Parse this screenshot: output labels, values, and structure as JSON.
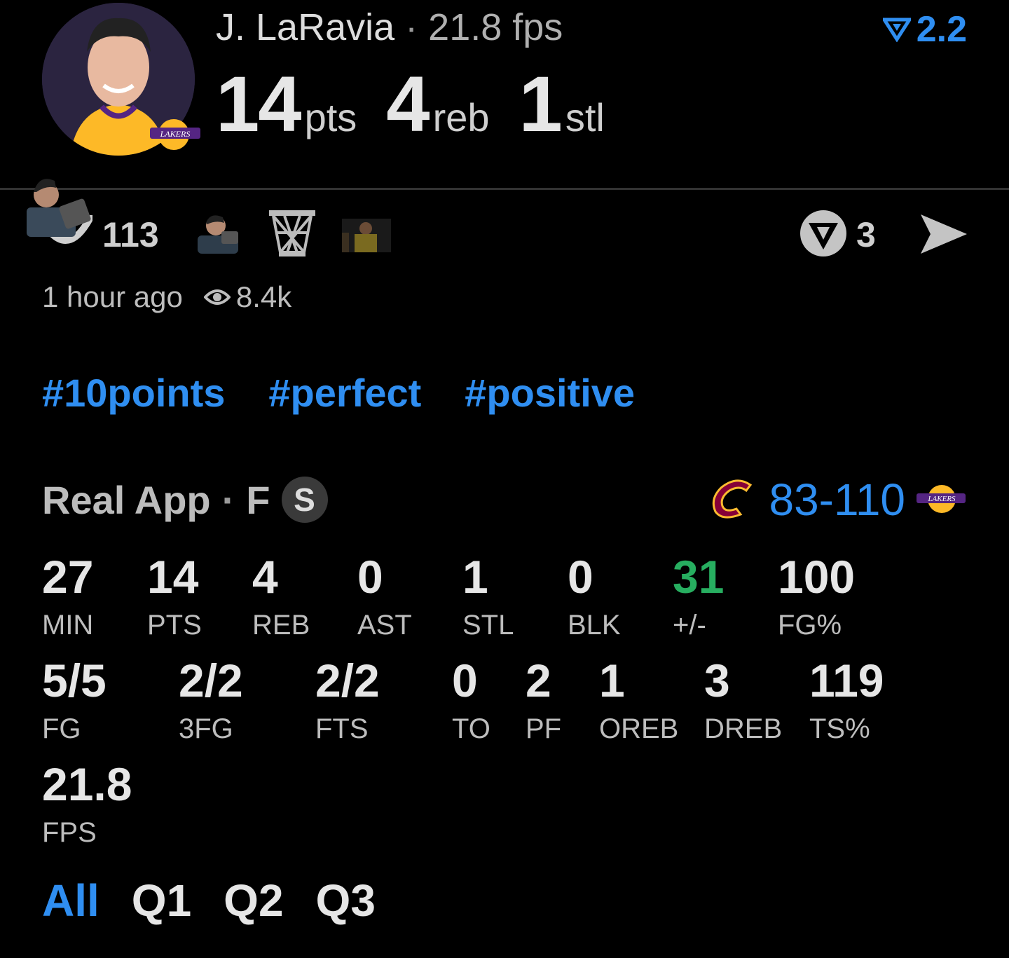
{
  "player": {
    "name": "J. LaRavia",
    "fps_text": "21.8 fps",
    "separator": "·",
    "pts": "14",
    "pts_unit": "pts",
    "reb": "4",
    "reb_unit": "reb",
    "stl": "1",
    "stl_unit": "stl",
    "rating": "2.2"
  },
  "reactions": {
    "count": "113",
    "share_count": "3"
  },
  "meta": {
    "time": "1 hour ago",
    "views": "8.4k"
  },
  "tags": [
    "#10points",
    "#perfect",
    "#positive"
  ],
  "game": {
    "source": "Real App",
    "position": "F",
    "s_badge": "S",
    "score": "83-110"
  },
  "stats": [
    {
      "value": "27",
      "label": "MIN"
    },
    {
      "value": "14",
      "label": "PTS"
    },
    {
      "value": "4",
      "label": "REB"
    },
    {
      "value": "0",
      "label": "AST"
    },
    {
      "value": "1",
      "label": "STL"
    },
    {
      "value": "0",
      "label": "BLK"
    },
    {
      "value": "31",
      "label": "+/-"
    },
    {
      "value": "100",
      "label": "FG%"
    },
    {
      "value": "5/5",
      "label": "FG"
    },
    {
      "value": "2/2",
      "label": "3FG"
    },
    {
      "value": "2/2",
      "label": "FTS"
    },
    {
      "value": "0",
      "label": "TO"
    },
    {
      "value": "2",
      "label": "PF"
    },
    {
      "value": "1",
      "label": "OREB"
    },
    {
      "value": "3",
      "label": "DREB"
    },
    {
      "value": "119",
      "label": "TS%"
    },
    {
      "value": "21.8",
      "label": "FPS"
    }
  ],
  "periods": [
    "All",
    "Q1",
    "Q2",
    "Q3"
  ],
  "colors": {
    "accent": "#2f8ef1",
    "positive": "#27ae60",
    "lakers_gold": "#fdb927",
    "lakers_purple": "#552583",
    "cavs_wine": "#860038"
  },
  "icons": {
    "rating": "chevron-down-triangle-icon",
    "reaction": "smile-icon",
    "basketball_hoop": "hoop-icon",
    "share": "send-icon",
    "views": "eye-icon"
  }
}
